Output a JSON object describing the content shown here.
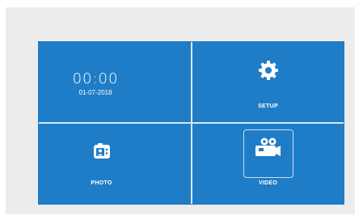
{
  "clock": {
    "time": "00:00",
    "date": "01-07-2018"
  },
  "tiles": {
    "setup": {
      "label": "SETUP",
      "icon": "gear-icon"
    },
    "photo": {
      "label": "PHOTO",
      "icon": "photo-icon"
    },
    "video": {
      "label": "VIDEO",
      "icon": "video-camera-icon"
    }
  },
  "colors": {
    "tile_blue": "#1f7dc7",
    "divider": "#d9e8f5",
    "frame_gray": "#ececec",
    "text": "#ffffff"
  }
}
